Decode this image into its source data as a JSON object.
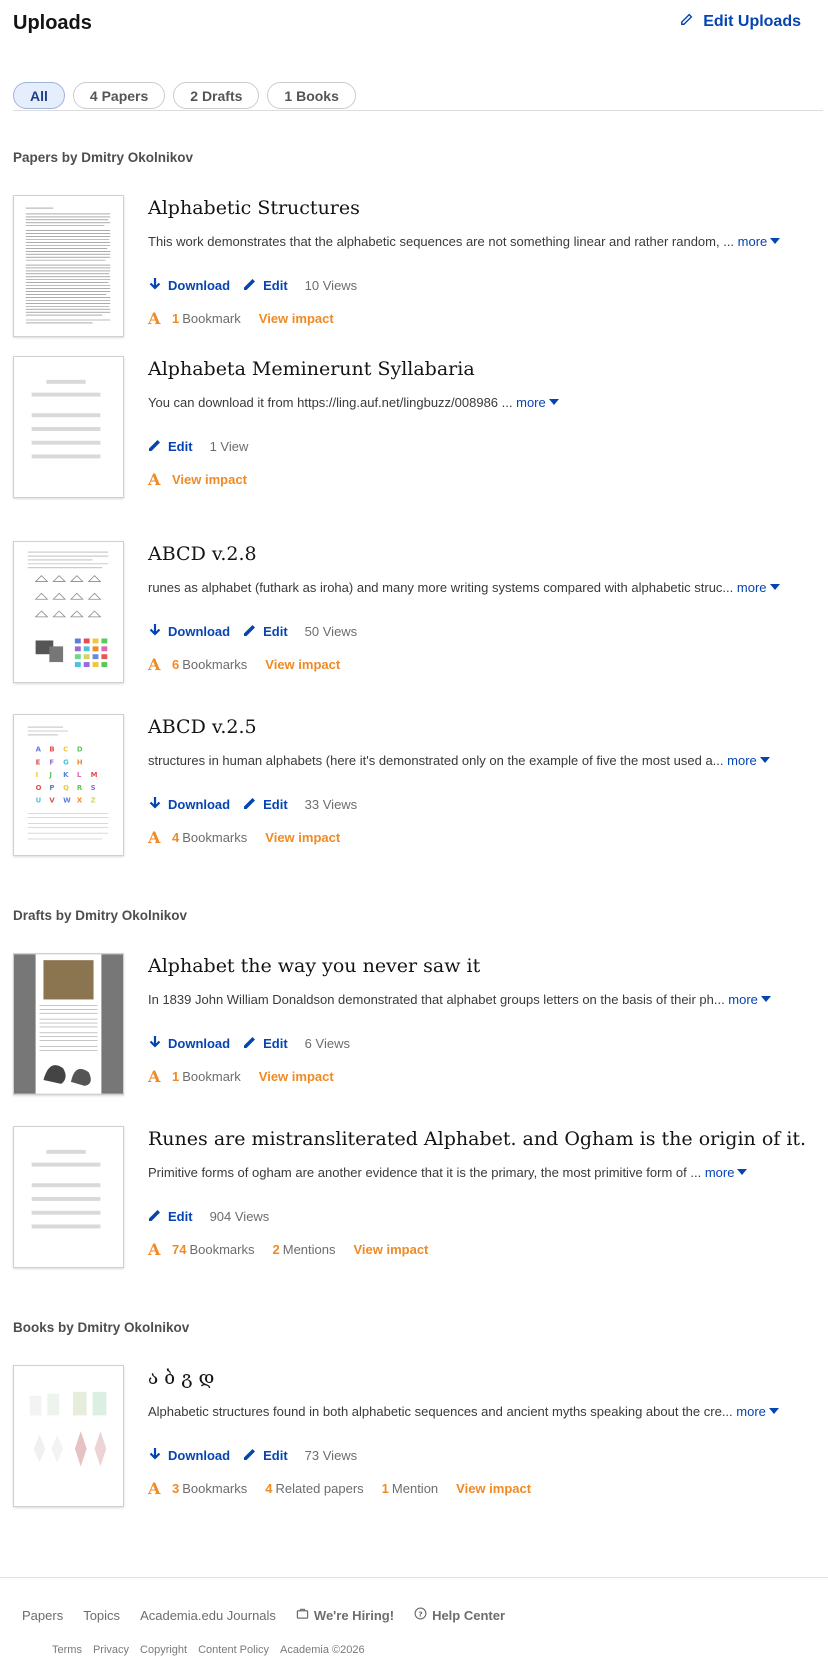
{
  "header": {
    "title": "Uploads",
    "edit_label": "Edit Uploads"
  },
  "tabs": [
    {
      "label": "All"
    },
    {
      "label": "4 Papers"
    },
    {
      "label": "2 Drafts"
    },
    {
      "label": "1 Books"
    }
  ],
  "sections": {
    "papers": "Papers by Dmitry Okolnikov",
    "drafts": "Drafts by Dmitry Okolnikov",
    "books": "Books by Dmitry Okolnikov"
  },
  "labels": {
    "download": "Download",
    "edit": "Edit",
    "more": "more",
    "view_impact": "View impact"
  },
  "items": [
    {
      "title": "Alphabetic Structures",
      "summary": "This work demonstrates that the alphabetic sequences are not something linear and rather random, ... ",
      "views": "10 Views",
      "stats": [
        {
          "num": "1",
          "label": "Bookmark"
        }
      ]
    },
    {
      "title": "Alphabeta Meminerunt Syllabaria",
      "summary": "You can download it from https://ling.auf.net/lingbuzz/008986 ... ",
      "views": "1 View",
      "stats": []
    },
    {
      "title": "ABCD v.2.8",
      "summary": "runes as alphabet (futhark as iroha) and many more writing systems compared with alphabetic struc... ",
      "views": "50 Views",
      "stats": [
        {
          "num": "6",
          "label": "Bookmarks"
        }
      ]
    },
    {
      "title": "ABCD v.2.5",
      "summary": "structures in human alphabets (here it's demonstrated only on the example of five the most used a... ",
      "views": "33 Views",
      "stats": [
        {
          "num": "4",
          "label": "Bookmarks"
        }
      ]
    },
    {
      "title": "Alphabet the way you never saw it",
      "summary": "In 1839 John William Donaldson demonstrated that alphabet groups letters on the basis of their ph... ",
      "views": "6 Views",
      "stats": [
        {
          "num": "1",
          "label": "Bookmark"
        }
      ]
    },
    {
      "title": "Runes are mistransliterated Alphabet. and Ogham is the origin of it.",
      "summary": "Primitive forms of ogham are another evidence that it is the primary, the most primitive form of ... ",
      "views": "904 Views",
      "stats": [
        {
          "num": "74",
          "label": "Bookmarks"
        },
        {
          "num": "2",
          "label": "Mentions"
        }
      ]
    },
    {
      "title": "ა ბ გ დ",
      "summary": "Alphabetic structures found in both alphabetic sequences and ancient myths speaking about the cre... ",
      "views": "73 Views",
      "stats": [
        {
          "num": "3",
          "label": "Bookmarks"
        },
        {
          "num": "4",
          "label": "Related papers"
        },
        {
          "num": "1",
          "label": "Mention"
        }
      ]
    }
  ],
  "footer": {
    "links": [
      "Papers",
      "Topics",
      "Academia.edu Journals",
      "We're Hiring!",
      "Help Center"
    ],
    "small": [
      "Terms",
      "Privacy",
      "Copyright",
      "Content Policy",
      "Academia ©2026"
    ]
  },
  "colors": {
    "link": "#0645b1",
    "impact": "#f08a24",
    "tab_active_bg": "#e6eefb"
  }
}
